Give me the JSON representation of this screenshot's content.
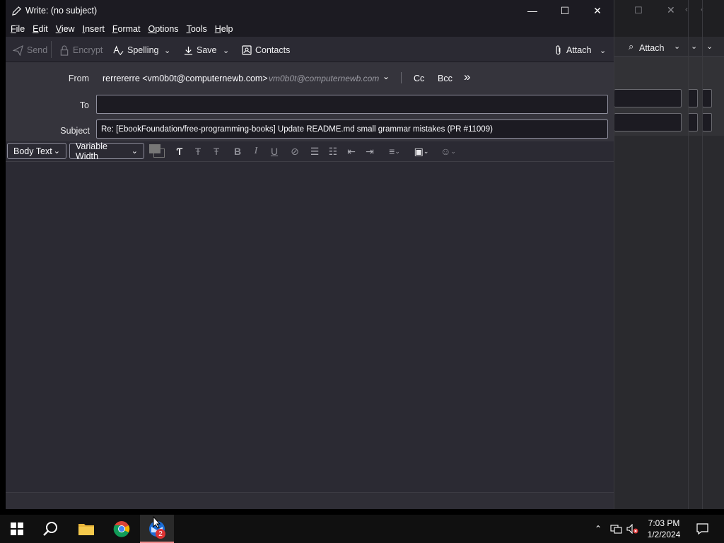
{
  "window": {
    "title": "Write: (no subject)",
    "minimize": "—",
    "maximize": "☐",
    "close": "✕"
  },
  "menu": [
    {
      "key": "F",
      "rest": "ile"
    },
    {
      "key": "E",
      "rest": "dit"
    },
    {
      "key": "V",
      "rest": "iew"
    },
    {
      "key": "I",
      "rest": "nsert"
    },
    {
      "key": "F",
      "rest": "ormat",
      "pre": ""
    },
    {
      "key": "O",
      "rest": "ptions"
    },
    {
      "key": "T",
      "rest": "ools"
    },
    {
      "key": "H",
      "rest": "elp"
    }
  ],
  "toolbar": {
    "send": "Send",
    "encrypt": "Encrypt",
    "spelling": "Spelling",
    "save": "Save",
    "contacts": "Contacts",
    "attach": "Attach",
    "attach_ghost": "Attach"
  },
  "header": {
    "from_label": "From",
    "from_identity": "rerrererre <vm0b0t@computernewb.com>",
    "from_email": "vm0b0t@computernewb.com",
    "cc": "Cc",
    "bcc": "Bcc",
    "more": "»",
    "to_label": "To",
    "to_value": "",
    "subject_label": "Subject",
    "subject_value": "Re: [EbookFoundation/free-programming-books] Update README.md small grammar mistakes (PR #11009)"
  },
  "format": {
    "paragraph": "Body Text",
    "font": "Variable Width"
  },
  "taskbar": {
    "badge": "2",
    "time": "7:03 PM",
    "date": "1/2/2024"
  },
  "colors": {
    "window_bg": "#2b2a33",
    "titlebar": "#1c1b22",
    "taskbar": "#101010",
    "accent": "#0078d4"
  }
}
